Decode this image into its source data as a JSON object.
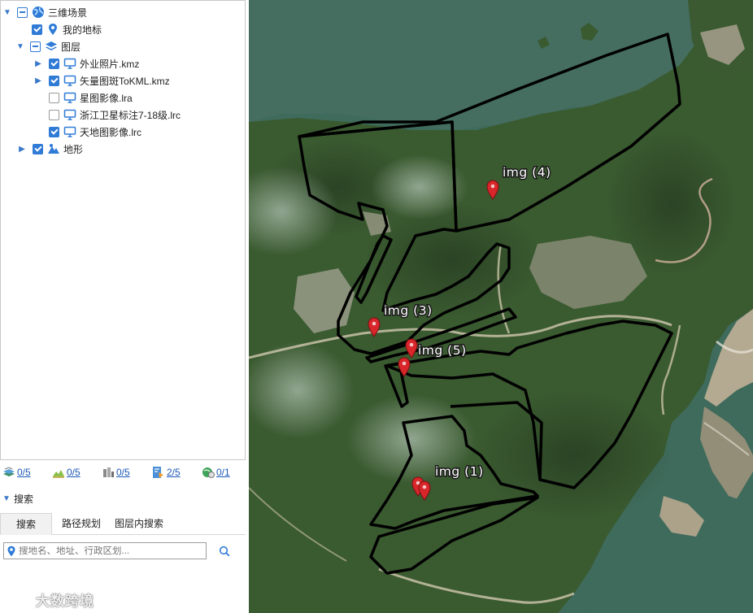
{
  "layer_tree": {
    "root": {
      "label": "三维场景",
      "expanded": true,
      "check": "partial"
    },
    "bookmark": {
      "label": "我的地标",
      "checked": true
    },
    "layers_group": {
      "label": "图层",
      "expanded": true,
      "check": "partial"
    },
    "layers": [
      {
        "label": "外业照片.kmz",
        "checked": true,
        "has_children": true
      },
      {
        "label": "矢量图斑ToKML.kmz",
        "checked": true,
        "has_children": true
      },
      {
        "label": "星图影像.lra",
        "checked": false,
        "has_children": false
      },
      {
        "label": "浙江卫星标注7-18级.lrc",
        "checked": false,
        "has_children": false
      },
      {
        "label": "天地图影像.lrc",
        "checked": true,
        "has_children": false
      }
    ],
    "terrain": {
      "label": "地形",
      "checked": true,
      "has_children": true
    }
  },
  "stats": [
    {
      "icon": "imagery-layers-icon",
      "value": "0/5"
    },
    {
      "icon": "terrain-layers-icon",
      "value": "0/5"
    },
    {
      "icon": "model-layers-icon",
      "value": "0/5"
    },
    {
      "icon": "vector-layers-icon",
      "value": "2/5"
    },
    {
      "icon": "service-layers-icon",
      "value": "0/1"
    }
  ],
  "search": {
    "header": "搜索",
    "tabs": [
      "搜索",
      "路径规划",
      "图层内搜索"
    ],
    "active_tab": 0,
    "placeholder": "搜地名、地址、行政区划..."
  },
  "watermark": {
    "text": "大数跨境"
  },
  "map": {
    "labels": [
      "img (4)",
      "img (3)",
      "img (5)",
      "img (1)"
    ],
    "marker_color": "#d9262b",
    "polygon_stroke": "#000000"
  },
  "colors": {
    "accent": "#2f7bd6",
    "link": "#1a57b8",
    "sea": "#3f6b5c",
    "forest": "#3a5a30"
  }
}
